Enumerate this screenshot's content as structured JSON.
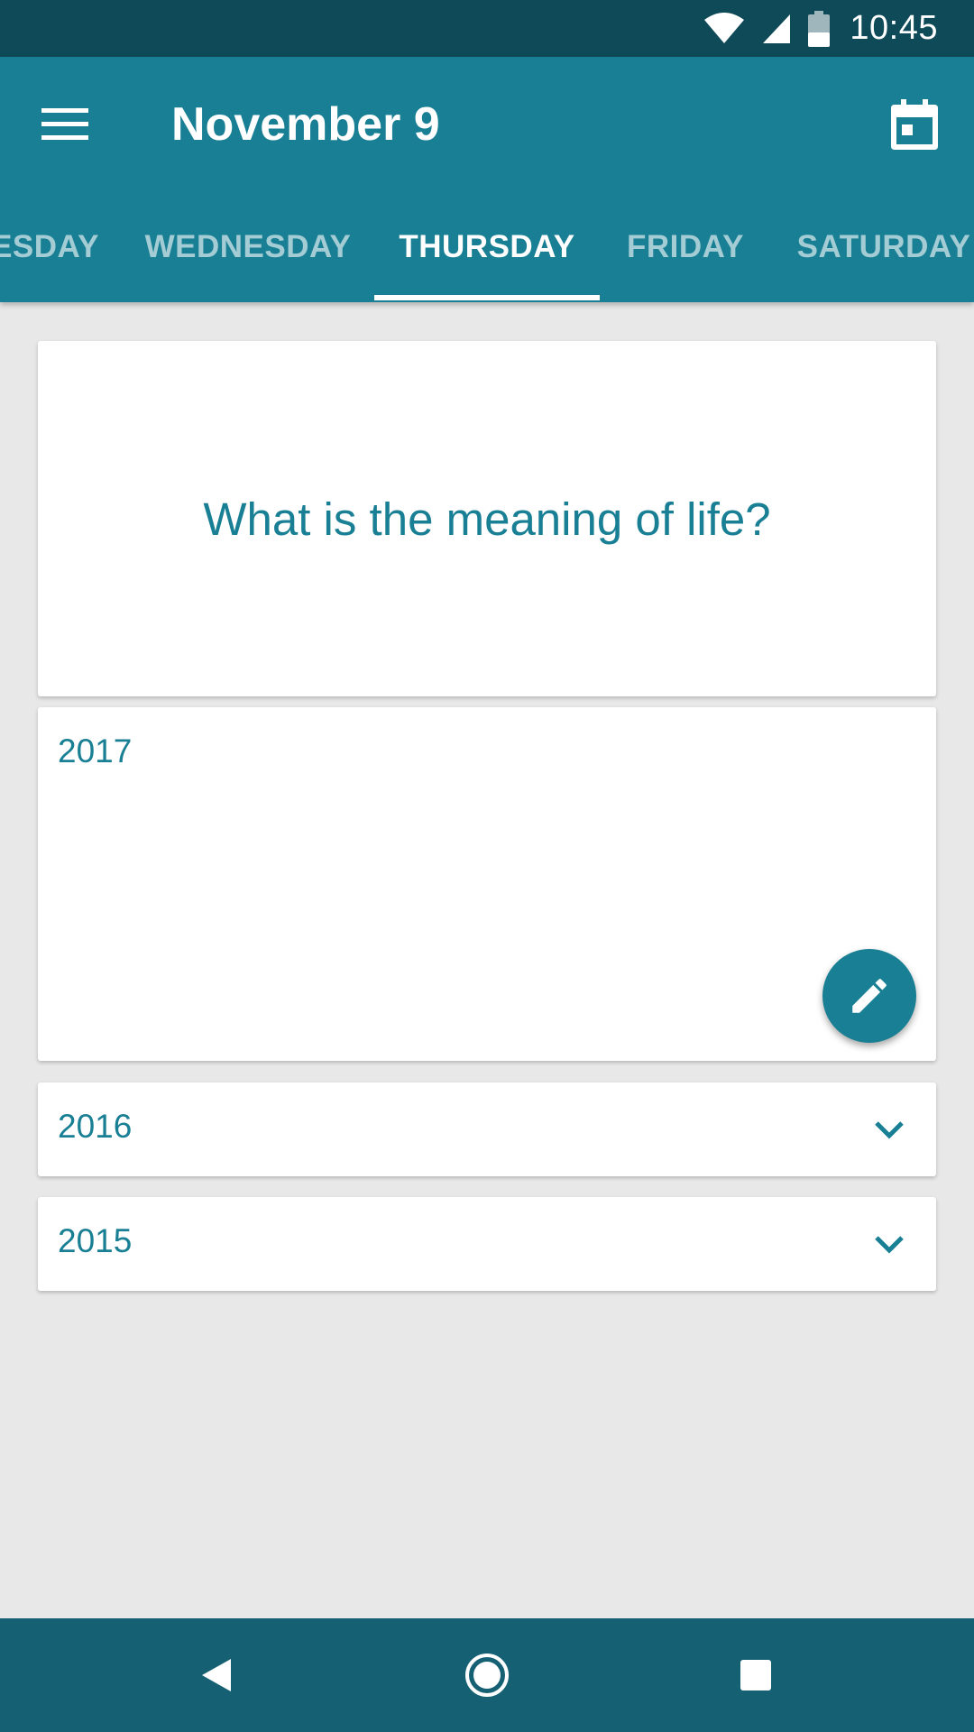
{
  "status_bar": {
    "time": "10:45",
    "icons": [
      "wifi-icon",
      "cell-signal-icon",
      "battery-icon"
    ]
  },
  "app_bar": {
    "title": "November 9",
    "menu_icon": "menu-icon",
    "calendar_icon": "calendar-icon",
    "background": "#197f94"
  },
  "tabs": {
    "items": [
      "ESDAY",
      "WEDNESDAY",
      "THURSDAY",
      "FRIDAY",
      "SATURDAY"
    ],
    "active": "THURSDAY"
  },
  "question": {
    "text": "What is the meaning of life?"
  },
  "entries": {
    "current": {
      "year": "2017"
    },
    "collapsed": [
      {
        "year": "2016",
        "icon": "chevron-down-icon"
      },
      {
        "year": "2015",
        "icon": "chevron-down-icon"
      }
    ]
  },
  "fab": {
    "icon": "pencil-icon"
  },
  "nav_bar": {
    "icons": [
      "back-icon",
      "home-icon",
      "recents-icon"
    ]
  },
  "colors": {
    "accent": "#197f94",
    "status_bar": "#0f4a58",
    "nav_bar": "#156173",
    "background": "#e8e8e8"
  }
}
